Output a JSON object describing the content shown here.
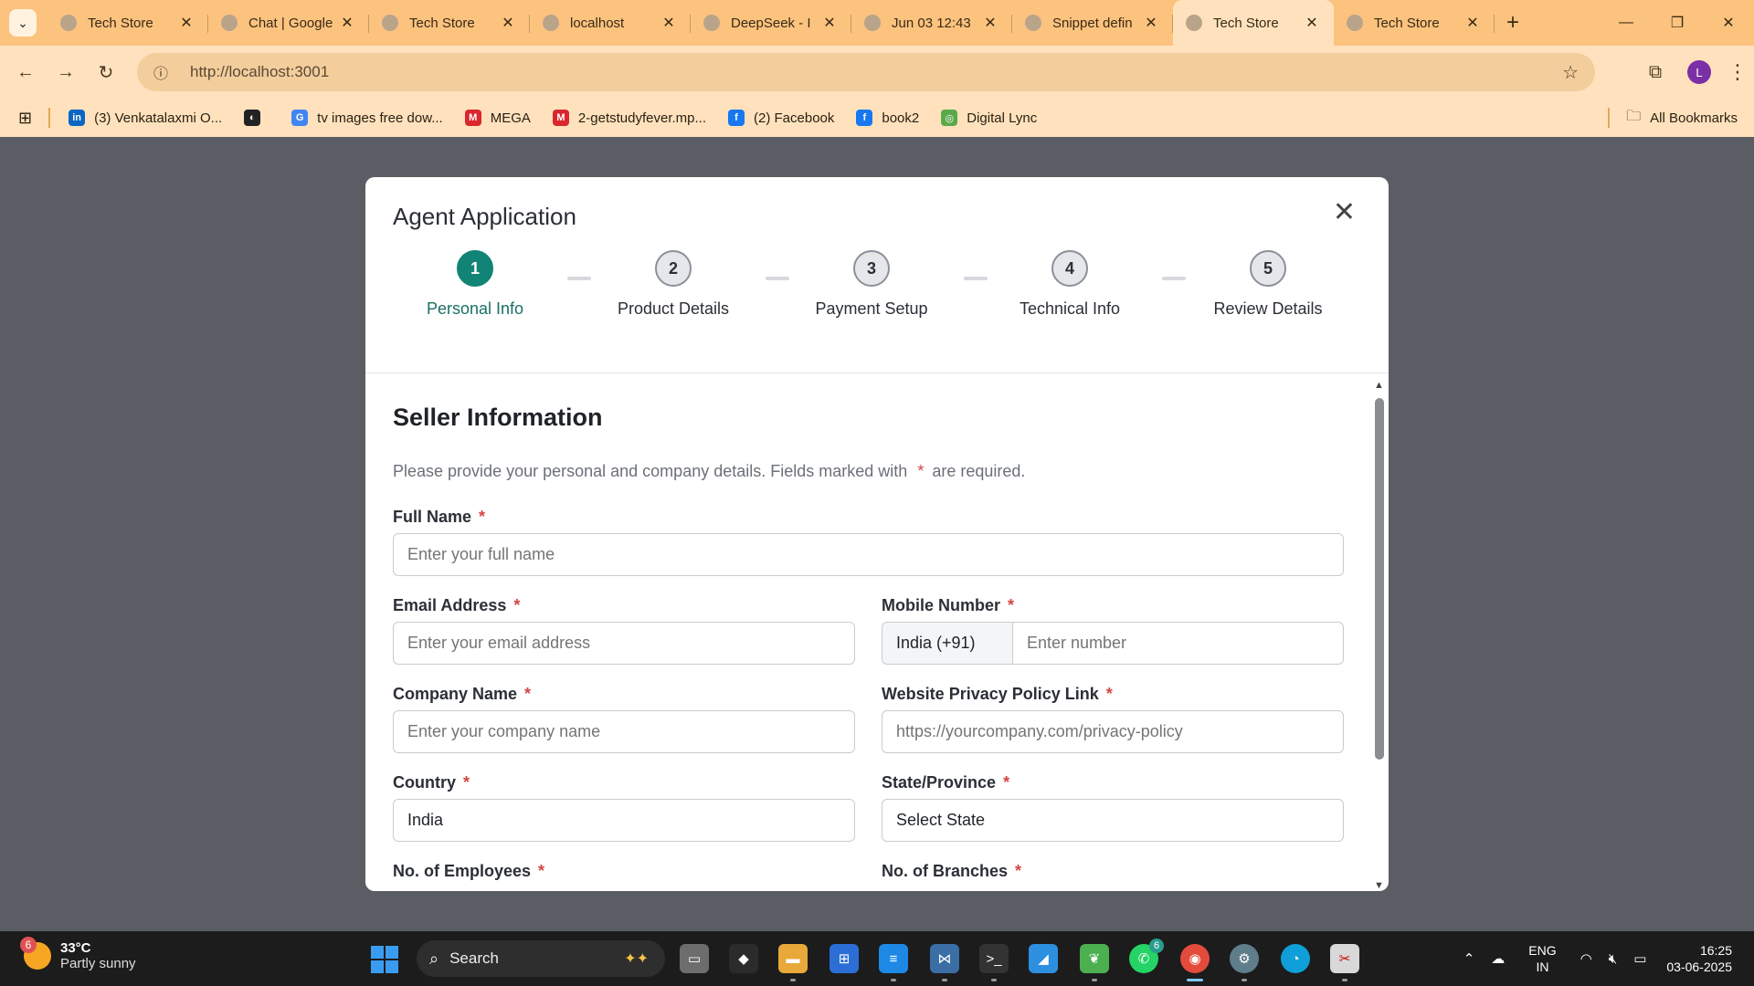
{
  "browser": {
    "tabs": [
      {
        "title": "Tech Store",
        "active": false,
        "icon": "globe-icon"
      },
      {
        "title": "Chat | Google",
        "active": false,
        "icon": "butterfly-icon"
      },
      {
        "title": "Tech Store",
        "active": false,
        "icon": "globe-icon"
      },
      {
        "title": "localhost",
        "active": false,
        "icon": "globe-icon"
      },
      {
        "title": "DeepSeek - I",
        "active": false,
        "icon": "whale-icon"
      },
      {
        "title": "Jun 03 12:43",
        "active": false,
        "icon": "tools-icon"
      },
      {
        "title": "Snippet defin",
        "active": false,
        "icon": "openai-icon"
      },
      {
        "title": "Tech Store",
        "active": true,
        "icon": "globe-icon"
      },
      {
        "title": "Tech Store",
        "active": false,
        "icon": "globe-icon"
      }
    ],
    "url": "http://localhost:3001",
    "avatar_letter": "L",
    "bookmarks": [
      {
        "label": "(3) Venkatalaxmi O...",
        "icon": "linkedin-icon",
        "color": "#0a66c2",
        "glyph": "in"
      },
      {
        "label": "",
        "icon": "globe-dark-icon",
        "color": "#222222",
        "glyph": "◐"
      },
      {
        "label": "tv images free dow...",
        "icon": "google-icon",
        "color": "#4285f4",
        "glyph": "G"
      },
      {
        "label": "MEGA",
        "icon": "mega-icon",
        "color": "#d9272e",
        "glyph": "M"
      },
      {
        "label": "2-getstudyfever.mp...",
        "icon": "mega-icon",
        "color": "#d9272e",
        "glyph": "M"
      },
      {
        "label": "(2) Facebook",
        "icon": "facebook-icon",
        "color": "#1877f2",
        "glyph": "f"
      },
      {
        "label": "book2",
        "icon": "facebook-icon",
        "color": "#1877f2",
        "glyph": "f"
      },
      {
        "label": "Digital Lync",
        "icon": "digital-lync-icon",
        "color": "#5aa84a",
        "glyph": "◎"
      }
    ],
    "all_bookmarks": "All Bookmarks"
  },
  "modal": {
    "title": "Agent Application",
    "steps": [
      {
        "number": "1",
        "label": "Personal Info",
        "active": true
      },
      {
        "number": "2",
        "label": "Product Details",
        "active": false
      },
      {
        "number": "3",
        "label": "Payment Setup",
        "active": false
      },
      {
        "number": "4",
        "label": "Technical Info",
        "active": false
      },
      {
        "number": "5",
        "label": "Review Details",
        "active": false
      }
    ],
    "section_title": "Seller Information",
    "section_desc_before": "Please provide your personal and company details. Fields marked with",
    "section_desc_star": "*",
    "section_desc_after": "are required.",
    "fields": {
      "full_name": {
        "label": "Full Name",
        "placeholder": "Enter your full name"
      },
      "email": {
        "label": "Email Address",
        "placeholder": "Enter your email address"
      },
      "mobile": {
        "label": "Mobile Number",
        "code": "India (+91)",
        "placeholder": "Enter number"
      },
      "company": {
        "label": "Company Name",
        "placeholder": "Enter your company name"
      },
      "privacy": {
        "label": "Website Privacy Policy Link",
        "placeholder": "https://yourcompany.com/privacy-policy"
      },
      "country": {
        "label": "Country",
        "value": "India"
      },
      "state": {
        "label": "State/Province",
        "value": "Select State"
      },
      "employees": {
        "label": "No. of Employees"
      },
      "branches": {
        "label": "No. of Branches"
      }
    },
    "required_star": "*"
  },
  "taskbar": {
    "weather_temp": "33°C",
    "weather_desc": "Partly sunny",
    "weather_badge": "6",
    "search_label": "Search",
    "whatsapp_badge": "6",
    "lang_line1": "ENG",
    "lang_line2": "IN",
    "time": "16:25",
    "date": "03-06-2025"
  },
  "colors": {
    "tab_bar": "#fcc37f",
    "toolbar": "#ffe2bd",
    "accent_teal": "#128476",
    "required_red": "#d64545"
  }
}
